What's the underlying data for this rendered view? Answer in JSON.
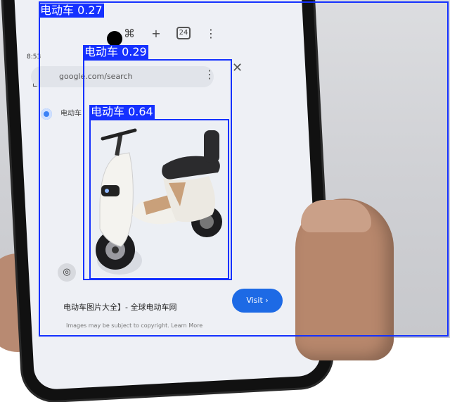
{
  "detections": [
    {
      "label": "电动车 0.27"
    },
    {
      "label": "电动车 0.29"
    },
    {
      "label": "电动车 0.64"
    }
  ],
  "colors": {
    "box": "#1531ff",
    "label_text": "#ffffff"
  },
  "phone": {
    "status_time": "8:53",
    "url": "google.com/search",
    "tab_count": "24",
    "site_name": "电动车",
    "result_title": "电动车图片大全】- 全球电动车网",
    "result_sub": "Images may be subject to copyright. Learn More",
    "visit_label": "Visit ›"
  }
}
